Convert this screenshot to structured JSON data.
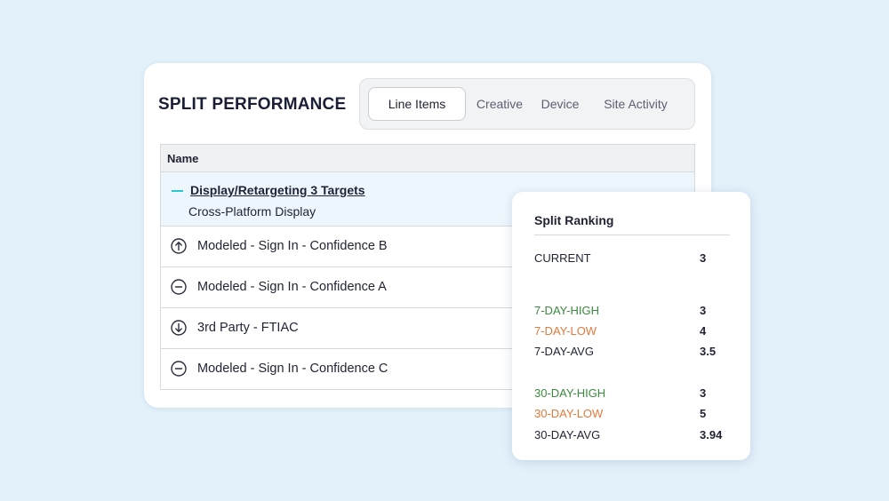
{
  "panel": {
    "title": "SPLIT PERFORMANCE",
    "tabs": [
      {
        "label": "Line Items",
        "active": true
      },
      {
        "label": "Creative"
      },
      {
        "label": "Device"
      },
      {
        "label": "Site Activity"
      }
    ]
  },
  "table": {
    "header": "Name",
    "group": {
      "title": "Display/Retargeting 3 Targets",
      "subtitle": "Cross-Platform Display",
      "toggle_icon": "collapse-dash-icon"
    },
    "rows": [
      {
        "icon": "arrow-up-circle-icon",
        "label": "Modeled - Sign In - Confidence B"
      },
      {
        "icon": "minus-circle-icon",
        "label": "Modeled - Sign In - Confidence A"
      },
      {
        "icon": "arrow-down-circle-icon",
        "label": "3rd Party - FTIAC"
      },
      {
        "icon": "minus-circle-icon",
        "label": "Modeled - Sign In - Confidence C"
      }
    ]
  },
  "ranking": {
    "title": "Split Ranking",
    "current": {
      "label": "CURRENT",
      "value": "3"
    },
    "seven_day": [
      {
        "label": "7-DAY-HIGH",
        "value": "3",
        "color": "#3b8a3f"
      },
      {
        "label": "7-DAY-LOW",
        "value": "4",
        "color": "#e07a3c"
      },
      {
        "label": "7-DAY-AVG",
        "value": "3.5",
        "color": "#1f2333"
      }
    ],
    "thirty_day": [
      {
        "label": "30-DAY-HIGH",
        "value": "3",
        "color": "#3b8a3f"
      },
      {
        "label": "30-DAY-LOW",
        "value": "5",
        "color": "#e07a3c"
      },
      {
        "label": "30-DAY-AVG",
        "value": "3.94",
        "color": "#1f2333"
      }
    ]
  }
}
